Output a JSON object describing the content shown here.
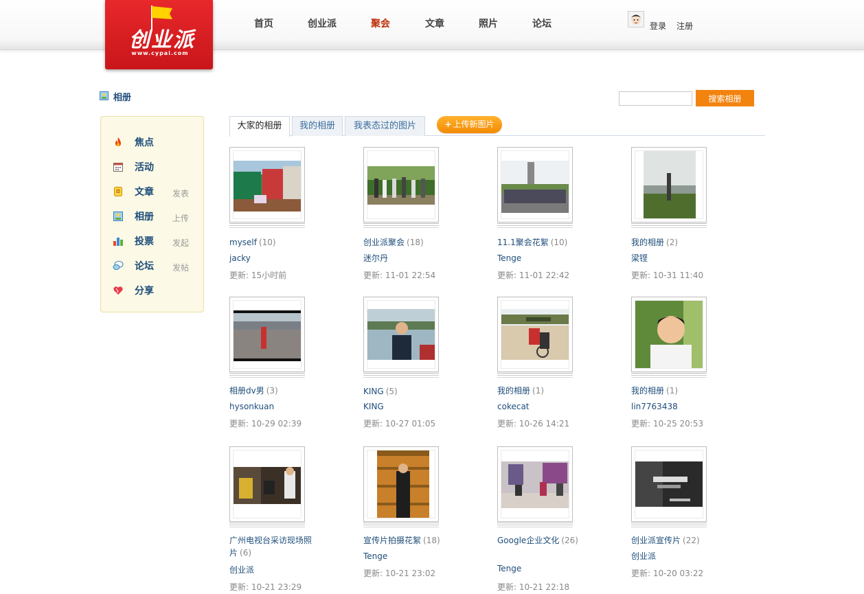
{
  "header": {
    "logo_text": "创业派",
    "logo_url": "www.cypai.com",
    "nav": [
      {
        "label": "首页",
        "active": false
      },
      {
        "label": "创业派",
        "active": false
      },
      {
        "label": "聚会",
        "active": true
      },
      {
        "label": "文章",
        "active": false
      },
      {
        "label": "照片",
        "active": false
      },
      {
        "label": "论坛",
        "active": false
      }
    ],
    "login": "登录",
    "register": "注册"
  },
  "page_title": "相册",
  "search": {
    "button": "搜索相册",
    "value": ""
  },
  "sidebar": [
    {
      "label": "焦点",
      "action": "",
      "icon": "fire-icon"
    },
    {
      "label": "活动",
      "action": "",
      "icon": "calendar-icon"
    },
    {
      "label": "文章",
      "action": "发表",
      "icon": "article-icon"
    },
    {
      "label": "相册",
      "action": "上传",
      "icon": "album-icon"
    },
    {
      "label": "投票",
      "action": "发起",
      "icon": "chart-icon"
    },
    {
      "label": "论坛",
      "action": "发帖",
      "icon": "forum-icon"
    },
    {
      "label": "分享",
      "action": "",
      "icon": "heart-icon"
    }
  ],
  "tabs": [
    {
      "label": "大家的相册",
      "active": true
    },
    {
      "label": "我的相册",
      "active": false
    },
    {
      "label": "我表态过的图片",
      "active": false
    }
  ],
  "upload_button": "上传新图片",
  "albums": [
    {
      "title": "myself",
      "count": "(10)",
      "user": "jacky",
      "updated": "更新: 15小时前"
    },
    {
      "title": "创业派聚会",
      "count": "(18)",
      "user": "迷尔丹",
      "updated": "更新: 11-01 22:54"
    },
    {
      "title": "11.1聚会花絮",
      "count": "(10)",
      "user": "Tenge",
      "updated": "更新: 11-01 22:42"
    },
    {
      "title": "我的相册",
      "count": "(2)",
      "user": "梁铿",
      "updated": "更新: 10-31 11:40"
    },
    {
      "title": "相册dv男",
      "count": "(3)",
      "user": "hysonkuan",
      "updated": "更新: 10-29 02:39"
    },
    {
      "title": "KING",
      "count": "(5)",
      "user": "KING",
      "updated": "更新: 10-27 01:05"
    },
    {
      "title": "我的相册",
      "count": "(1)",
      "user": "cokecat",
      "updated": "更新: 10-26 14:21"
    },
    {
      "title": "我的相册",
      "count": "(1)",
      "user": "lin7763438",
      "updated": "更新: 10-25 20:53"
    },
    {
      "title": "广州电视台采访现场照片",
      "count": "(6)",
      "user": "创业派",
      "updated": "更新: 10-21 23:29"
    },
    {
      "title": "宣传片拍摄花絮",
      "count": "(18)",
      "user": "Tenge",
      "updated": "更新: 10-21 23:02"
    },
    {
      "title": "Google企业文化",
      "count": "(26)",
      "user": "Tenge",
      "updated": "更新: 10-21 22:18"
    },
    {
      "title": "创业派宣传片",
      "count": "(22)",
      "user": "创业派",
      "updated": "更新: 10-20 03:22"
    }
  ]
}
